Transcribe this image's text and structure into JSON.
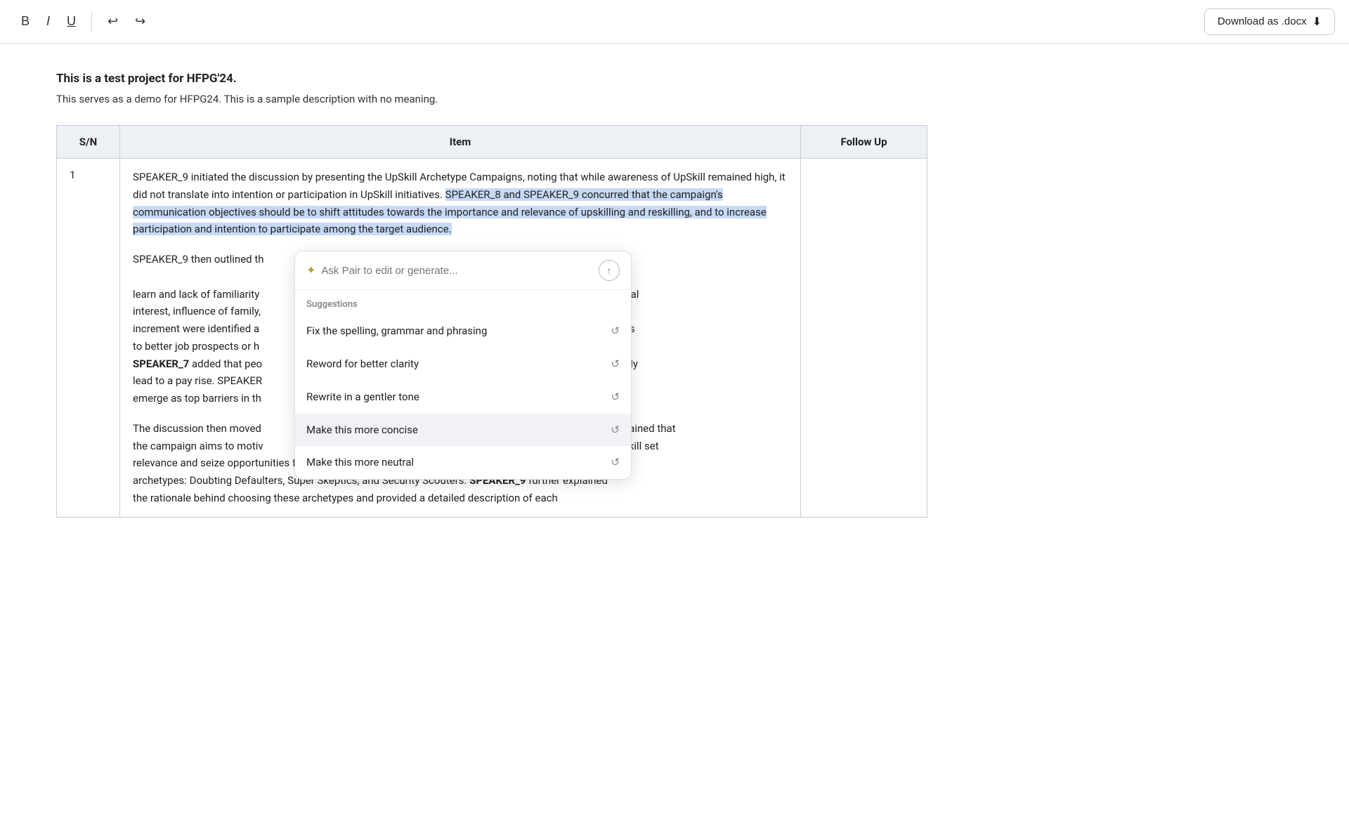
{
  "toolbar": {
    "bold_label": "B",
    "italic_label": "I",
    "underline_label": "U",
    "undo_label": "↩",
    "redo_label": "↪",
    "download_button": "Download as .docx"
  },
  "document": {
    "title": "This is a test project for HFPG'24.",
    "description": "This serves as a demo for HFPG24. This is a sample description with no meaning."
  },
  "table": {
    "headers": {
      "sn": "S/N",
      "item": "Item",
      "followup": "Follow Up"
    },
    "row1": {
      "sn": "1",
      "para1_pre_highlight": "SPEAKER_9 initiated the discussion by presenting the UpSkill Archetype Campaigns, noting that while awareness of UpSkill remained high, it did not translate into intention or participation in UpSkill initiatives. ",
      "para1_highlighted": "SPEAKER_8 and SPEAKER_9 concurred that the campaign's communication objectives should be to shift attitudes towards the importance and relevance of upskilling and reskilling, and to increase participation and intention to participate among the target audience.",
      "para2": "SPEAKER_9 then outlined the barriers to upskilling, such as lack of knowledge of what to learn and lack of familiarity with subsidies, personal interest, influence of family, promotion or wage increment were identified as upskilling leads to better job prospects or higher to adoption. SPEAKER_7 added that people to automatically lead to a pay rise. SPEAKER issues did not emerge as top barriers in the",
      "para3": "The discussion then moved SPEAKER_9 explained that the campaign aims to motivate their skill set relevance and seize opportunities for career growth. The target audience was identified as three archetypes: Doubting Defaulters, Super Skeptics, and Security Scouters. SPEAKER_9 further explained the rationale behind choosing these archetypes and provided a detailed description of each"
    }
  },
  "ai_popup": {
    "placeholder": "Ask Pair to edit or generate...",
    "suggestions_label": "Suggestions",
    "suggestions": [
      {
        "label": "Fix the spelling, grammar and phrasing",
        "icon": "↺"
      },
      {
        "label": "Reword for better clarity",
        "icon": "↺"
      },
      {
        "label": "Rewrite in a gentler tone",
        "icon": "↺"
      },
      {
        "label": "Make this more concise",
        "icon": "↺",
        "active": true
      },
      {
        "label": "Make this more neutral",
        "icon": "↺"
      }
    ]
  }
}
